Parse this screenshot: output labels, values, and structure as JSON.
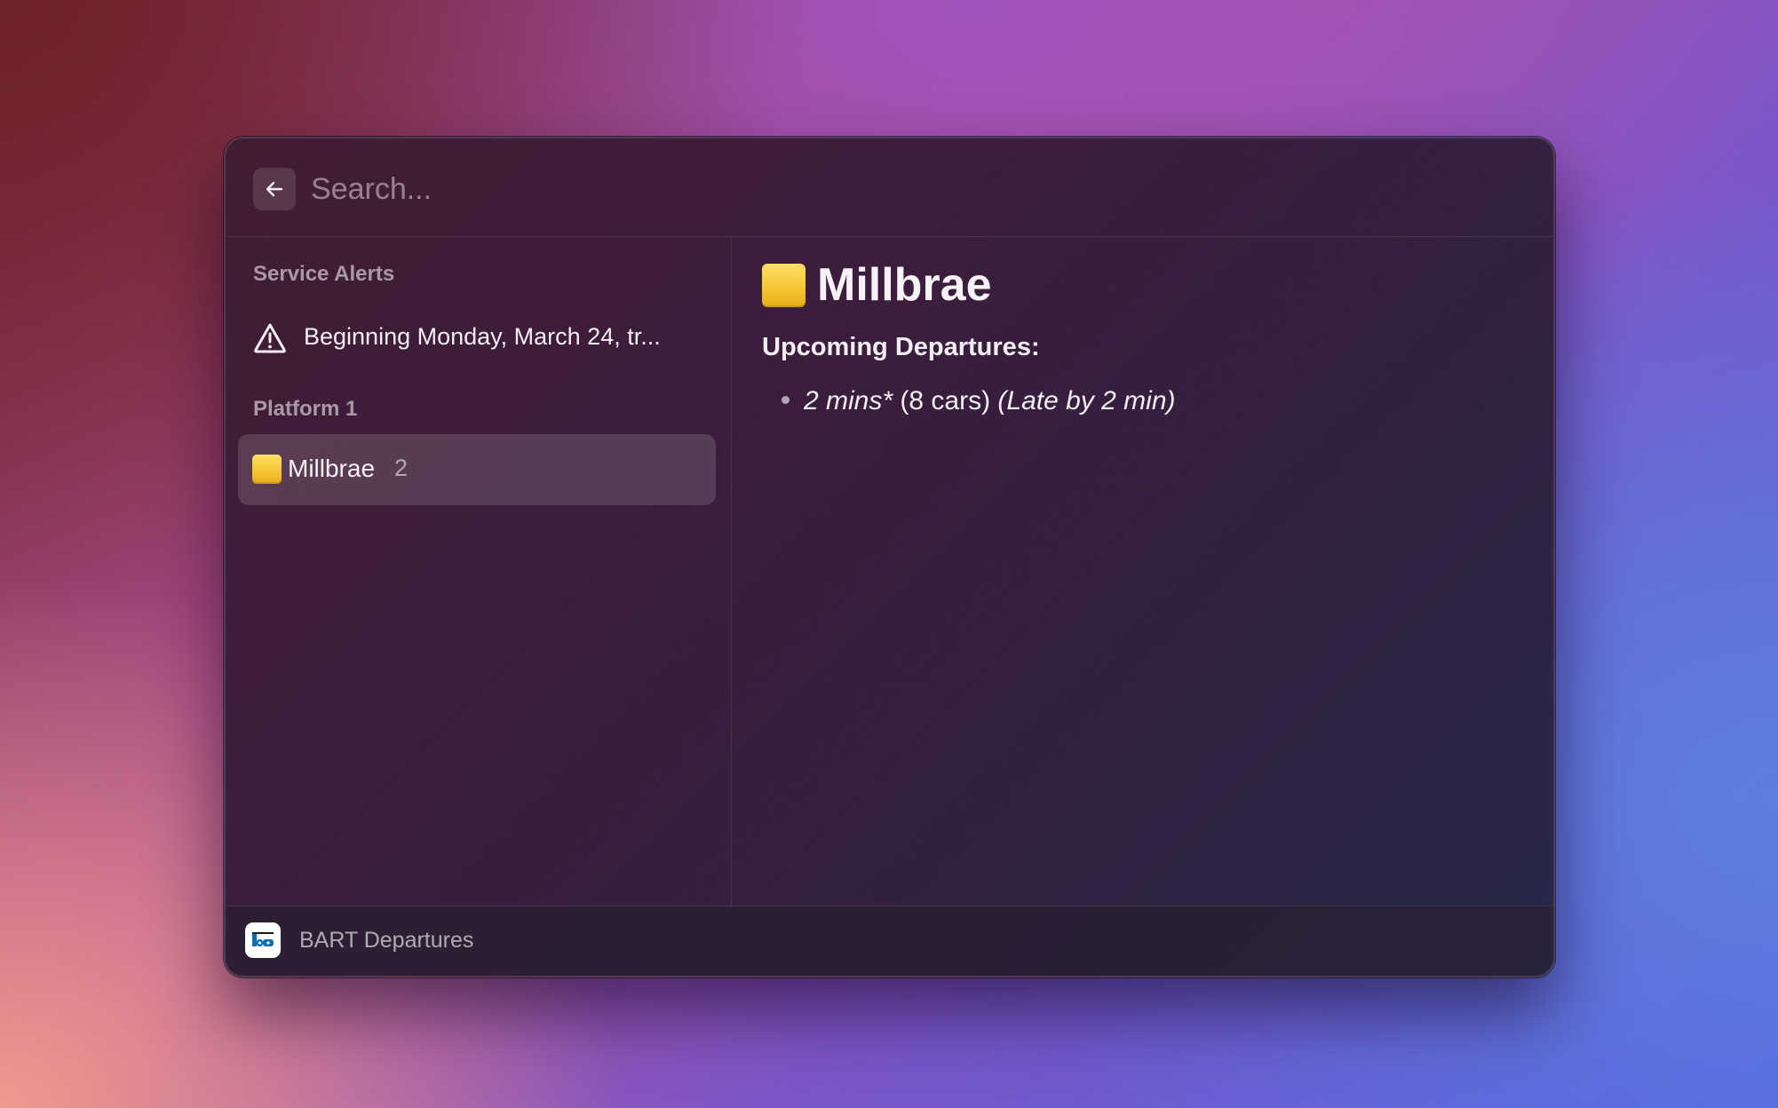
{
  "search": {
    "placeholder": "Search...",
    "back_icon": "arrow-left-icon"
  },
  "sidebar": {
    "sections": [
      {
        "title": "Service Alerts",
        "items": [
          {
            "icon": "warning-triangle-icon",
            "label": "Beginning Monday, March 24, tr..."
          }
        ]
      },
      {
        "title": "Platform 1",
        "items": [
          {
            "icon": "yellow-square-icon",
            "label": "Millbrae",
            "count": "2",
            "selected": true
          }
        ]
      }
    ]
  },
  "detail": {
    "title": "Millbrae",
    "title_icon": "yellow-square-icon",
    "subtitle": "Upcoming Departures:",
    "departures": [
      {
        "time": "2 mins*",
        "cars": "(8 cars)",
        "status": "(Late by 2 min)"
      }
    ]
  },
  "footer": {
    "app_icon": "bart-logo-icon",
    "app_name": "BART Departures"
  },
  "colors": {
    "line_color": "#f6c431"
  }
}
